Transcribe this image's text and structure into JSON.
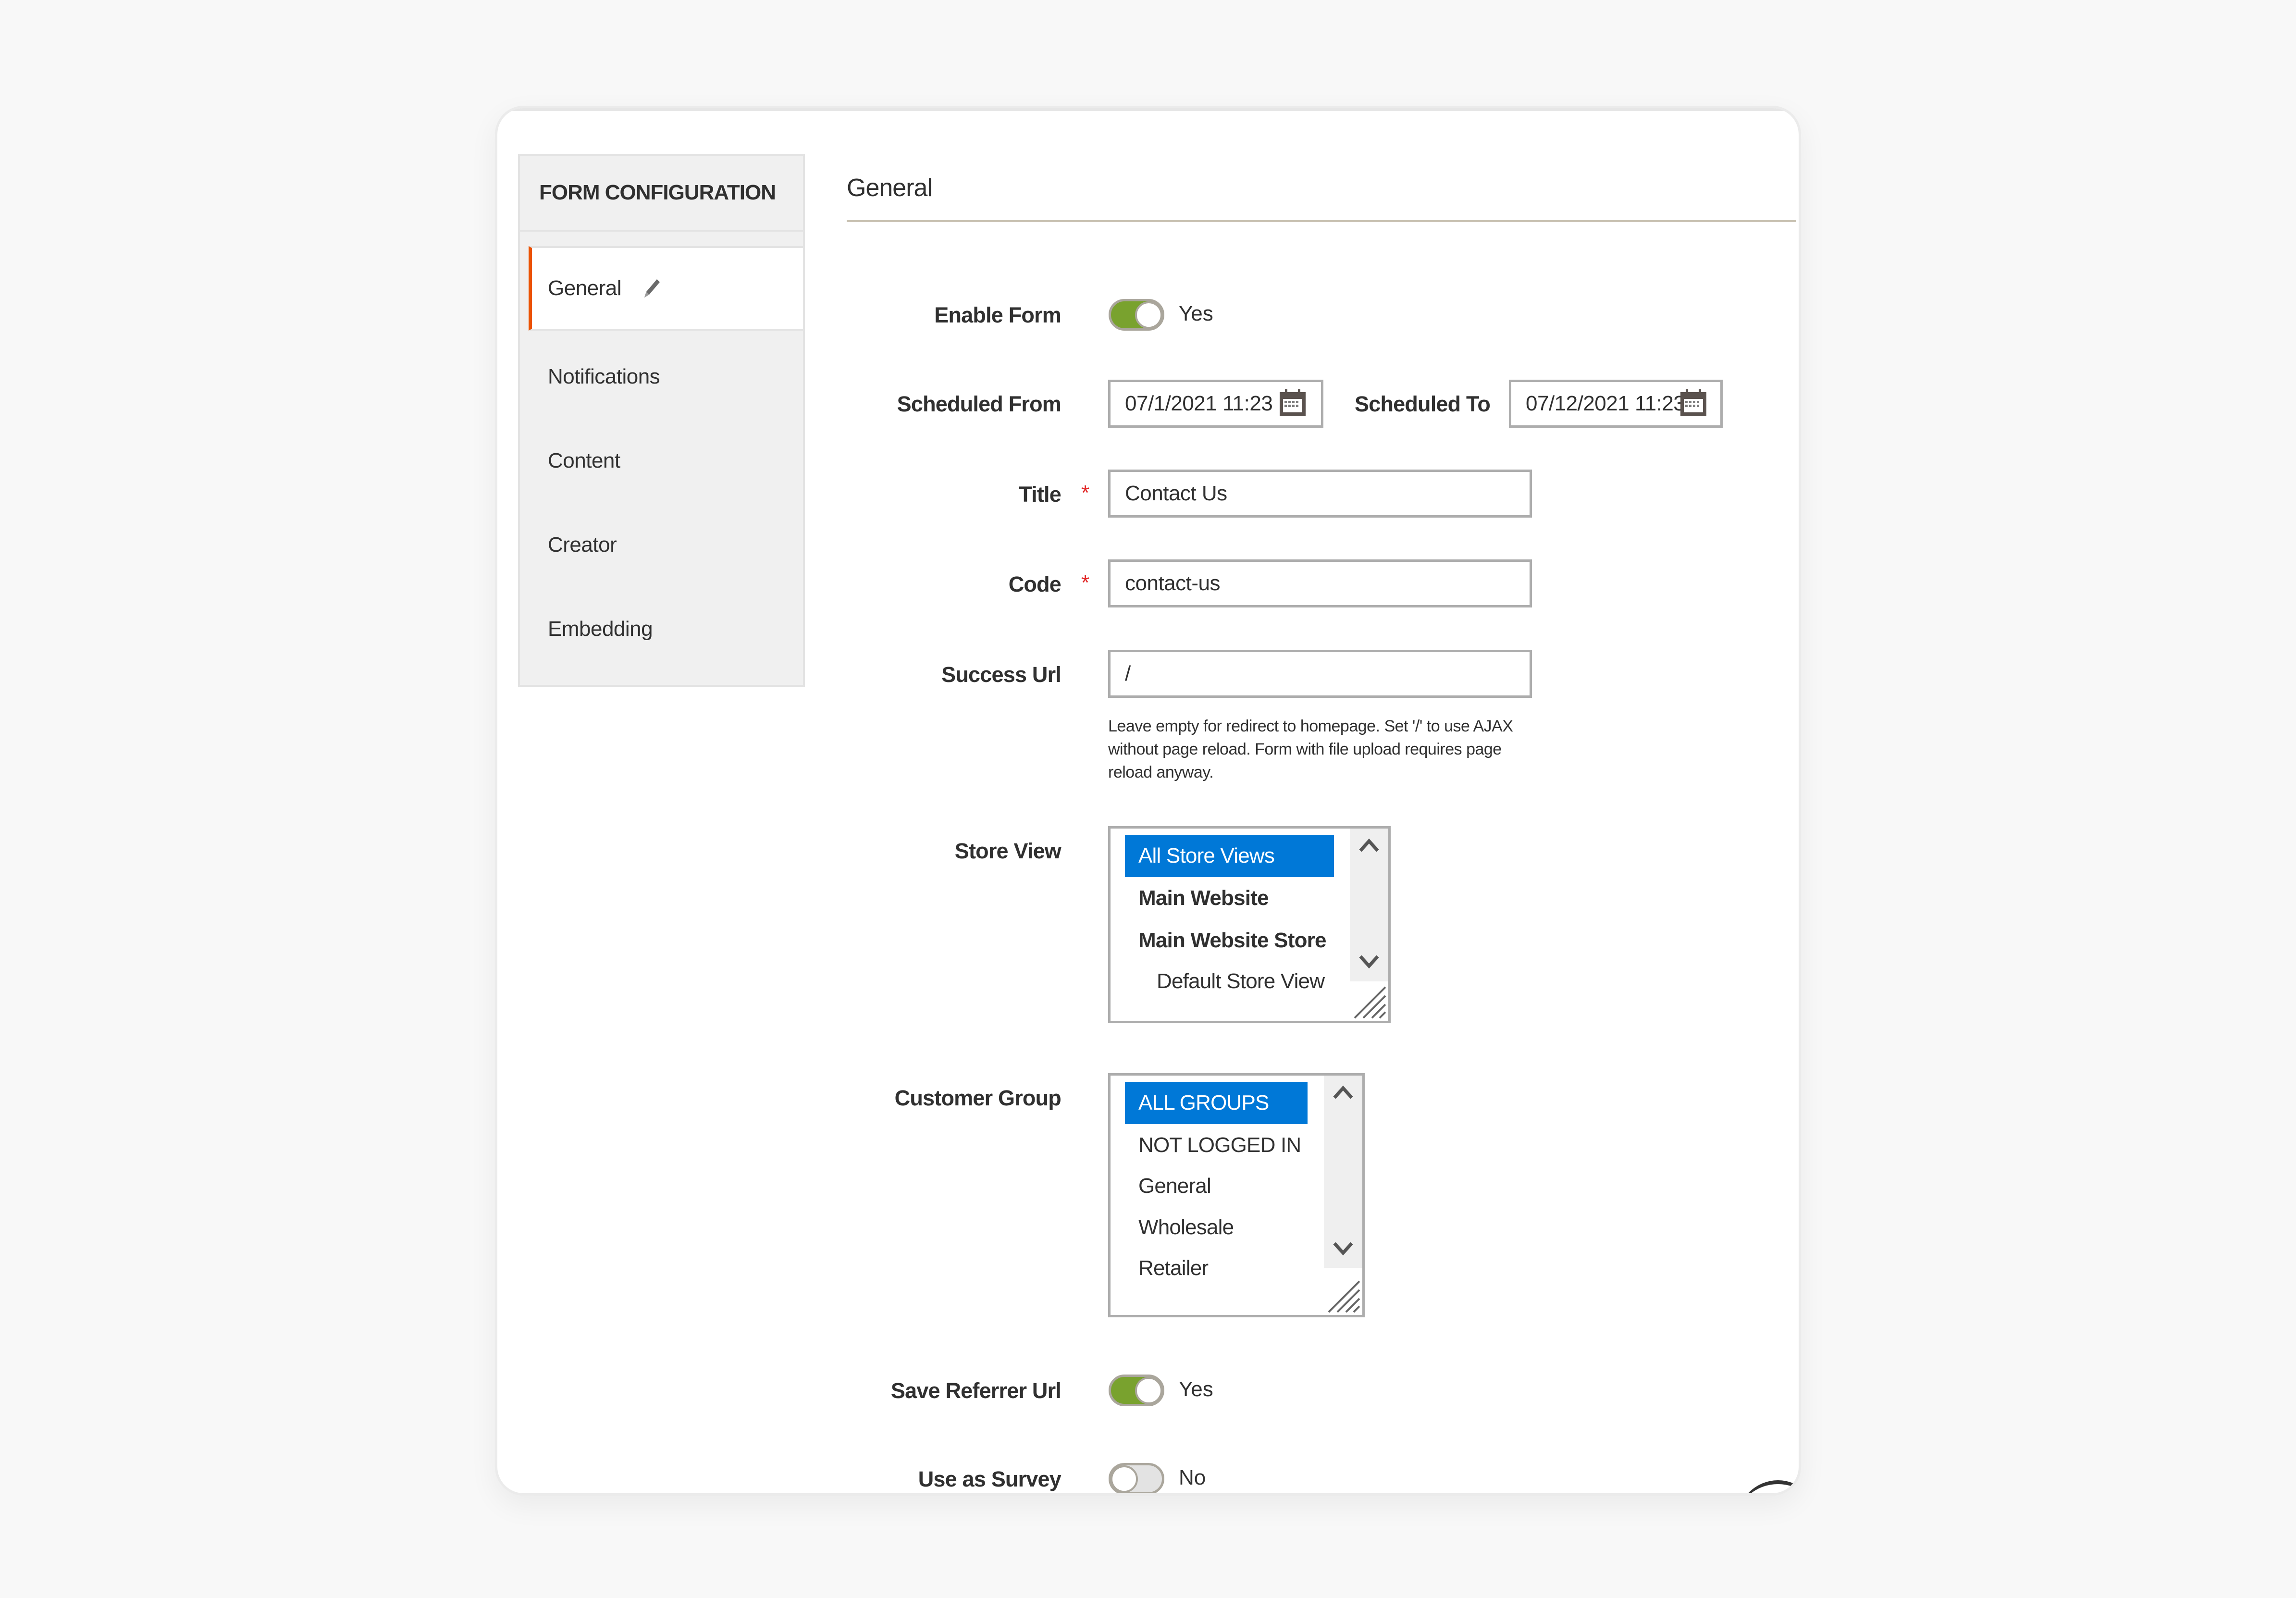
{
  "sidebar": {
    "header": "FORM CONFIGURATION",
    "items": [
      {
        "label": "General",
        "active": true,
        "icon": "pencil-icon"
      },
      {
        "label": "Notifications",
        "active": false
      },
      {
        "label": "Content",
        "active": false
      },
      {
        "label": "Creator",
        "active": false
      },
      {
        "label": "Embedding",
        "active": false
      }
    ]
  },
  "main": {
    "title": "General",
    "fields": {
      "enable_form": {
        "label": "Enable Form",
        "value": true,
        "state_text": "Yes"
      },
      "scheduled_from": {
        "label": "Scheduled From",
        "value": "07/1/2021 11:23",
        "icon": "calendar-icon"
      },
      "scheduled_to": {
        "label": "Scheduled To",
        "value": "07/12/2021 11:23",
        "icon": "calendar-icon"
      },
      "title": {
        "label": "Title",
        "required": "*",
        "value": "Contact Us"
      },
      "code": {
        "label": "Code",
        "required": "*",
        "value": "contact-us"
      },
      "success_url": {
        "label": "Success Url",
        "value": "/",
        "help": "Leave empty for redirect to homepage. Set '/' to use AJAX without page reload. Form with file upload requires page reload anyway."
      },
      "store_view": {
        "label": "Store View",
        "options": [
          {
            "label": "All Store Views",
            "selected": true,
            "bold": false,
            "indent": 0
          },
          {
            "label": "Main Website",
            "selected": false,
            "bold": true,
            "indent": 0
          },
          {
            "label": "Main Website Store",
            "selected": false,
            "bold": true,
            "indent": 0
          },
          {
            "label": "Default Store View",
            "selected": false,
            "bold": false,
            "indent": 1
          }
        ]
      },
      "customer_group": {
        "label": "Customer Group",
        "options": [
          {
            "label": "ALL GROUPS",
            "selected": true
          },
          {
            "label": "NOT LOGGED IN",
            "selected": false
          },
          {
            "label": "General",
            "selected": false
          },
          {
            "label": "Wholesale",
            "selected": false
          },
          {
            "label": "Retailer",
            "selected": false
          }
        ]
      },
      "save_referrer_url": {
        "label": "Save Referrer Url",
        "value": true,
        "state_text": "Yes"
      },
      "use_as_survey": {
        "label": "Use as Survey",
        "value": false,
        "state_text": "No"
      }
    }
  },
  "colors": {
    "accent_active": "#eb5202",
    "toggle_on": "#79a22e",
    "selection": "#0078d7",
    "required": "#e22626"
  }
}
